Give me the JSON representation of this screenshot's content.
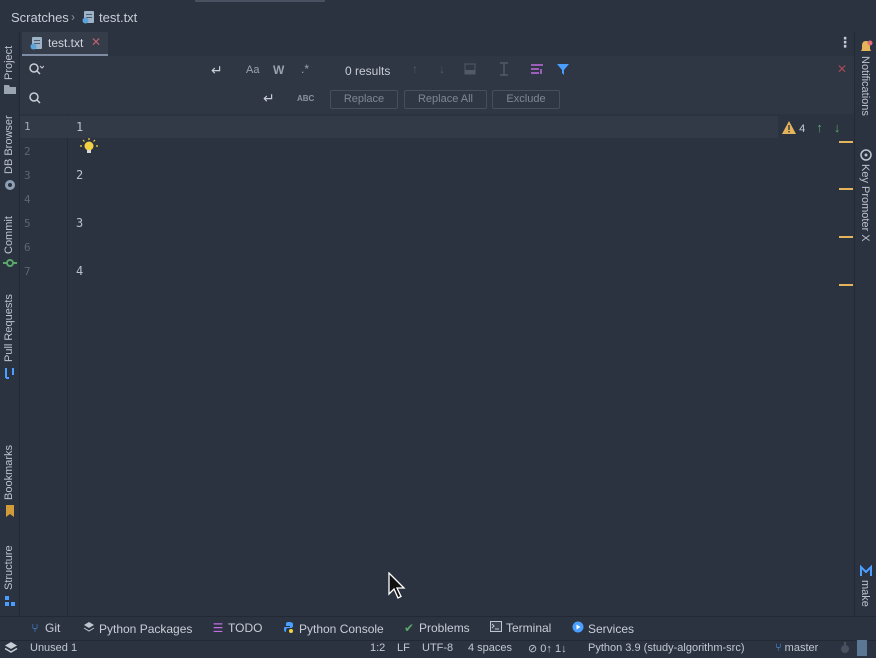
{
  "breadcrumb": {
    "root": "Scratches",
    "separator": "›",
    "file": "test.txt"
  },
  "editor_tab": {
    "label": "test.txt",
    "close_glyph": "✕"
  },
  "find": {
    "results": "0 results",
    "match_case": "Aa",
    "words": "W",
    "regex": ".*"
  },
  "replace": {
    "preserve_case": "ABC",
    "replace_label": "Replace",
    "replace_all_label": "Replace All",
    "exclude_label": "Exclude"
  },
  "gutter": {
    "lines": [
      "1",
      "2",
      "3",
      "4",
      "5",
      "6",
      "7"
    ]
  },
  "code": {
    "line1": "1",
    "line3": "2",
    "line5": "3",
    "line7": "4"
  },
  "inspections": {
    "warning_count": "4"
  },
  "left_tools": {
    "project": "Project",
    "db_browser": "DB Browser",
    "commit": "Commit",
    "pull_requests": "Pull Requests",
    "bookmarks": "Bookmarks",
    "structure": "Structure"
  },
  "right_tools": {
    "notifications": "Notifications",
    "key_promoter": "Key Promoter X",
    "make": "make"
  },
  "bottom_tools": {
    "git": "Git",
    "python_packages": "Python Packages",
    "todo": "TODO",
    "python_console": "Python Console",
    "problems": "Problems",
    "terminal": "Terminal",
    "services": "Services"
  },
  "status": {
    "unused": "Unused 1",
    "position": "1:2",
    "line_sep": "LF",
    "encoding": "UTF-8",
    "indent": "4 spaces",
    "vcs_arrows": "0↑ 1↓",
    "interpreter": "Python 3.9 (study-algorithm-src)",
    "branch": "master"
  },
  "colors": {
    "background": "#2b3240",
    "warning": "#e5b45a",
    "accent_blue": "#4a9eff",
    "git_green": "#59a869"
  },
  "icons": [
    "search-icon",
    "close-icon",
    "filter-icon",
    "lightbulb-icon",
    "warning-icon",
    "arrow-up-icon",
    "arrow-down-icon",
    "branch-icon",
    "mouse-cursor-icon"
  ]
}
